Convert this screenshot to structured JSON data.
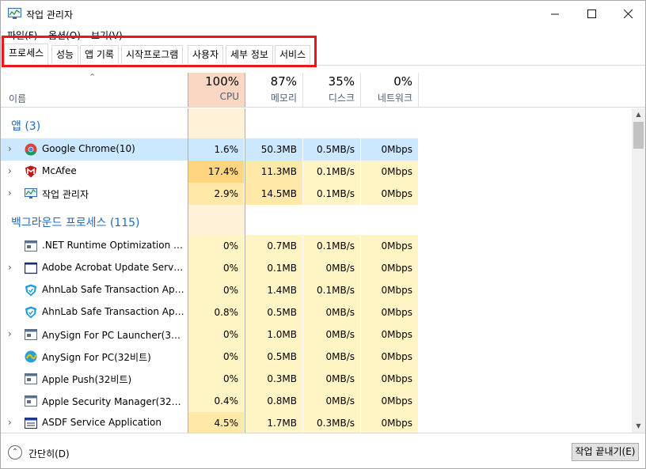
{
  "window": {
    "title": "작업 관리자",
    "minimize_icon": "minimize-icon",
    "maximize_icon": "maximize-icon",
    "close_icon": "close-icon"
  },
  "menu": [
    "파일(F)",
    "옵션(O)",
    "보기(V)"
  ],
  "tabs": [
    "프로세스",
    "성능",
    "앱 기록",
    "시작프로그램",
    "사용자",
    "세부 정보",
    "서비스"
  ],
  "highlight_color": "#e8181d",
  "columns": {
    "name": "이름",
    "cpu": {
      "pct": "100%",
      "label": "CPU"
    },
    "mem": {
      "pct": "87%",
      "label": "메모리"
    },
    "disk": {
      "pct": "35%",
      "label": "디스크"
    },
    "net": {
      "pct": "0%",
      "label": "네트워크"
    }
  },
  "groups": {
    "apps": "앱 (3)",
    "background": "백그라운드 프로세스 (115)"
  },
  "apps": [
    {
      "name": "Google Chrome(10)",
      "icon": "chrome-icon",
      "expandable": true,
      "cpu": "1.6%",
      "mem": "50.3MB",
      "disk": "0.5MB/s",
      "net": "0Mbps",
      "selected": true
    },
    {
      "name": "McAfee",
      "icon": "mcafee-icon",
      "expandable": true,
      "cpu": "17.4%",
      "mem": "11.3MB",
      "disk": "0.1MB/s",
      "net": "0Mbps"
    },
    {
      "name": "작업 관리자",
      "icon": "task-manager-icon",
      "expandable": true,
      "cpu": "2.9%",
      "mem": "14.5MB",
      "disk": "0.1MB/s",
      "net": "0Mbps"
    }
  ],
  "background": [
    {
      "name": ".NET Runtime Optimization Ser...",
      "icon": "app-window-icon",
      "expandable": false,
      "cpu": "0%",
      "mem": "0.7MB",
      "disk": "0.1MB/s",
      "net": "0Mbps"
    },
    {
      "name": "Adobe Acrobat Update Service...",
      "icon": "blank-window-icon",
      "expandable": true,
      "cpu": "0%",
      "mem": "0.1MB",
      "disk": "0MB/s",
      "net": "0Mbps"
    },
    {
      "name": "AhnLab Safe Transaction Appli...",
      "icon": "ahnlab-shield-icon",
      "expandable": false,
      "cpu": "0%",
      "mem": "1.4MB",
      "disk": "0.1MB/s",
      "net": "0Mbps"
    },
    {
      "name": "AhnLab Safe Transaction Appli...",
      "icon": "ahnlab-shield-icon",
      "expandable": false,
      "cpu": "0.8%",
      "mem": "0.5MB",
      "disk": "0MB/s",
      "net": "0Mbps"
    },
    {
      "name": "AnySign For PC Launcher(32비트)",
      "icon": "app-window-icon",
      "expandable": true,
      "cpu": "0%",
      "mem": "1.0MB",
      "disk": "0MB/s",
      "net": "0Mbps"
    },
    {
      "name": "AnySign For PC(32비트)",
      "icon": "anysign-icon",
      "expandable": false,
      "cpu": "0%",
      "mem": "0.5MB",
      "disk": "0MB/s",
      "net": "0Mbps"
    },
    {
      "name": "Apple Push(32비트)",
      "icon": "app-window-icon",
      "expandable": false,
      "cpu": "0%",
      "mem": "0.3MB",
      "disk": "0MB/s",
      "net": "0Mbps"
    },
    {
      "name": "Apple Security Manager(32비트)",
      "icon": "app-window-icon",
      "expandable": false,
      "cpu": "0.4%",
      "mem": "0.8MB",
      "disk": "0MB/s",
      "net": "0Mbps"
    },
    {
      "name": "ASDF Service Application",
      "icon": "service-app-icon",
      "expandable": true,
      "cpu": "4.5%",
      "mem": "1.7MB",
      "disk": "0.3MB/s",
      "net": "0Mbps"
    }
  ],
  "footer": {
    "collapse_label": "간단히(D)",
    "end_task_label": "작업 끝내기(E)"
  }
}
